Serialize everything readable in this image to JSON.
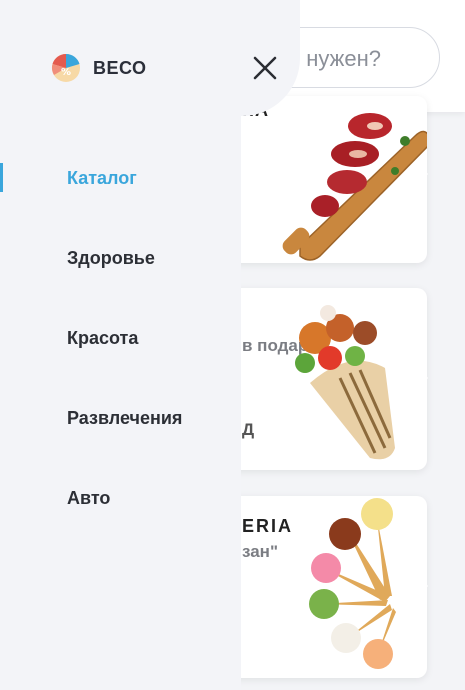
{
  "search": {
    "placeholder_visible": "м нужен?"
  },
  "cards": [
    {
      "title": "КА",
      "subtitle": ""
    },
    {
      "title": "",
      "subtitle": "в подарок",
      "footer": "Д"
    },
    {
      "title": "ERIA",
      "subtitle": "зан\""
    }
  ],
  "drawer": {
    "brand": "ВЕСО",
    "nav": [
      {
        "label": "Каталог",
        "active": true
      },
      {
        "label": "Здоровье",
        "active": false
      },
      {
        "label": "Красота",
        "active": false
      },
      {
        "label": "Развлечения",
        "active": false
      },
      {
        "label": "Авто",
        "active": false
      }
    ]
  },
  "colors": {
    "accent": "#3aa6dc",
    "drawer_bg": "#f3f4f8",
    "text": "#2c2f36"
  },
  "icons": {
    "logo": "veso-logo-icon",
    "close": "close-icon"
  }
}
